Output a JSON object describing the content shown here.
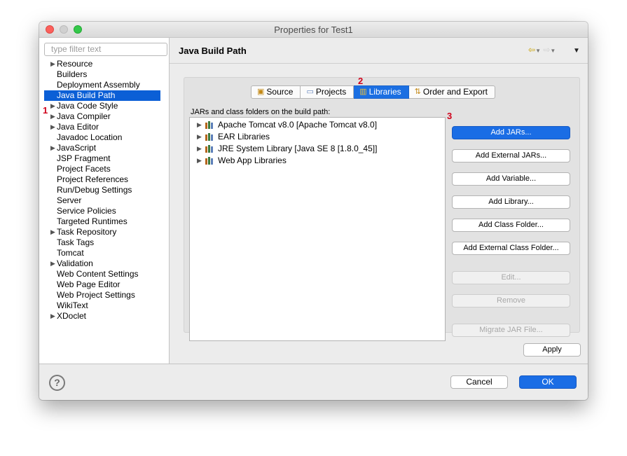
{
  "window": {
    "title": "Properties for Test1"
  },
  "left_panel": {
    "filter_placeholder": "type filter text",
    "items": [
      {
        "label": "Resource",
        "expandable": true
      },
      {
        "label": "Builders",
        "expandable": false
      },
      {
        "label": "Deployment Assembly",
        "expandable": false
      },
      {
        "label": "Java Build Path",
        "expandable": false,
        "selected": true
      },
      {
        "label": "Java Code Style",
        "expandable": true
      },
      {
        "label": "Java Compiler",
        "expandable": true
      },
      {
        "label": "Java Editor",
        "expandable": true
      },
      {
        "label": "Javadoc Location",
        "expandable": false
      },
      {
        "label": "JavaScript",
        "expandable": true
      },
      {
        "label": "JSP Fragment",
        "expandable": false
      },
      {
        "label": "Project Facets",
        "expandable": false
      },
      {
        "label": "Project References",
        "expandable": false
      },
      {
        "label": "Run/Debug Settings",
        "expandable": false
      },
      {
        "label": "Server",
        "expandable": false
      },
      {
        "label": "Service Policies",
        "expandable": false
      },
      {
        "label": "Targeted Runtimes",
        "expandable": false
      },
      {
        "label": "Task Repository",
        "expandable": true
      },
      {
        "label": "Task Tags",
        "expandable": false
      },
      {
        "label": "Tomcat",
        "expandable": false
      },
      {
        "label": "Validation",
        "expandable": true
      },
      {
        "label": "Web Content Settings",
        "expandable": false
      },
      {
        "label": "Web Page Editor",
        "expandable": false
      },
      {
        "label": "Web Project Settings",
        "expandable": false
      },
      {
        "label": "WikiText",
        "expandable": false
      },
      {
        "label": "XDoclet",
        "expandable": true
      }
    ]
  },
  "annotations": {
    "step1": "1",
    "step2": "2",
    "step3": "3"
  },
  "main": {
    "title": "Java Build Path",
    "tabs": [
      {
        "label": "Source",
        "icon": "source-folder-icon"
      },
      {
        "label": "Projects",
        "icon": "folder-icon"
      },
      {
        "label": "Libraries",
        "icon": "library-icon",
        "active": true
      },
      {
        "label": "Order and Export",
        "icon": "order-export-icon"
      }
    ],
    "list_label": "JARs and class folders on the build path:",
    "libraries": [
      "Apache Tomcat v8.0 [Apache Tomcat v8.0]",
      "EAR Libraries",
      "JRE System Library [Java SE 8 [1.8.0_45]]",
      "Web App Libraries"
    ],
    "buttons": {
      "add_jars": "Add JARs...",
      "add_external_jars": "Add External JARs...",
      "add_variable": "Add Variable...",
      "add_library": "Add Library...",
      "add_class_folder": "Add Class Folder...",
      "add_external_class_folder": "Add External Class Folder...",
      "edit": "Edit...",
      "remove": "Remove",
      "migrate_jar": "Migrate JAR File..."
    },
    "apply": "Apply"
  },
  "footer": {
    "help": "?",
    "cancel": "Cancel",
    "ok": "OK"
  },
  "colors": {
    "accent": "#1a6de5",
    "selection": "#0b5fd6",
    "annotation": "#d0021b"
  }
}
